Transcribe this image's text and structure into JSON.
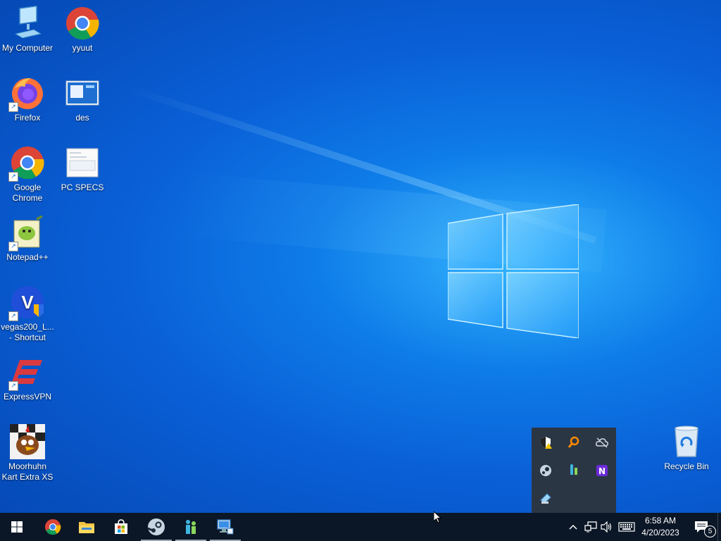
{
  "desktop_icons": [
    {
      "label": "My Computer"
    },
    {
      "label": "yyuut"
    },
    {
      "label": "Firefox"
    },
    {
      "label": "des"
    },
    {
      "label": "Google Chrome"
    },
    {
      "label": "PC SPECS"
    },
    {
      "label": "Notepad++"
    },
    {
      "label": "vegas200_L... - Shortcut"
    },
    {
      "label": "ExpressVPN"
    },
    {
      "label": "Moorhuhn Kart Extra XS"
    },
    {
      "label": "Recycle Bin"
    }
  ],
  "tray_overflow": [
    "security-warning-icon",
    "search-tool-icon",
    "cloud-offline-icon",
    "steam-icon",
    "network-app-icon",
    "n-app-icon",
    "usb-device-icon"
  ],
  "taskbar": {
    "apps": [
      "start-icon",
      "chrome-icon",
      "file-explorer-icon",
      "store-icon",
      "steam-icon",
      "network-users-icon",
      "remote-desktop-icon"
    ],
    "clock_time": "6:58 AM",
    "clock_date": "4/20/2023",
    "notification_count": "5"
  },
  "colors": {
    "taskbar": "#0b1626",
    "accent": "#0a5fd6",
    "flyout": "#2b3645"
  }
}
